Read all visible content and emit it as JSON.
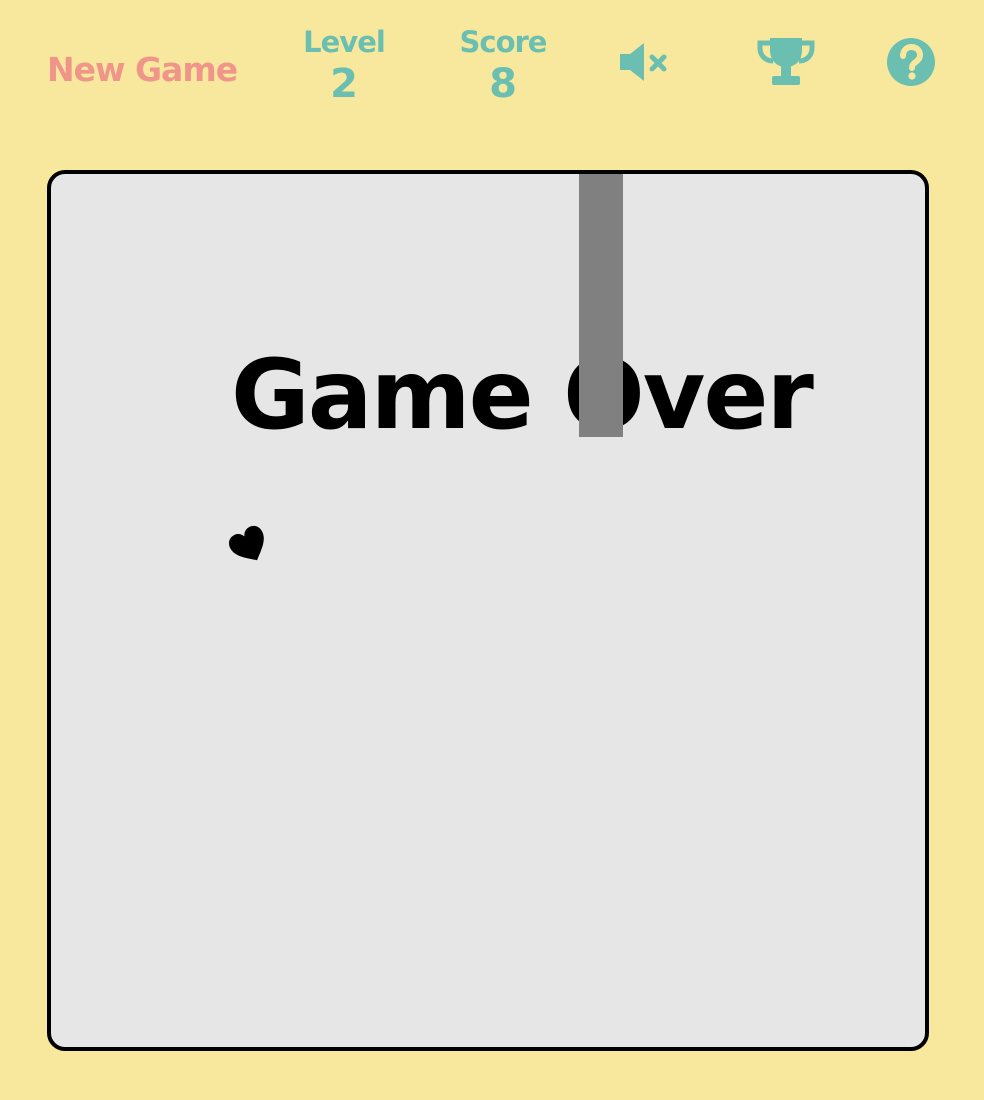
{
  "header": {
    "new_game_label": "New Game",
    "level_label": "Level",
    "level_value": "2",
    "score_label": "Score",
    "score_value": "8",
    "sound_icon": "volume-mute-icon",
    "leaderboard_icon": "trophy-icon",
    "help_icon": "question-circle-icon"
  },
  "board": {
    "status_text": "Game Over",
    "player_icon": "heart-icon",
    "obstacle": "pipe"
  },
  "colors": {
    "background": "#f8e89e",
    "accent_teal": "#6abfb0",
    "accent_coral": "#f0958a",
    "board": "#e6e6e6",
    "pipe": "#808080"
  }
}
